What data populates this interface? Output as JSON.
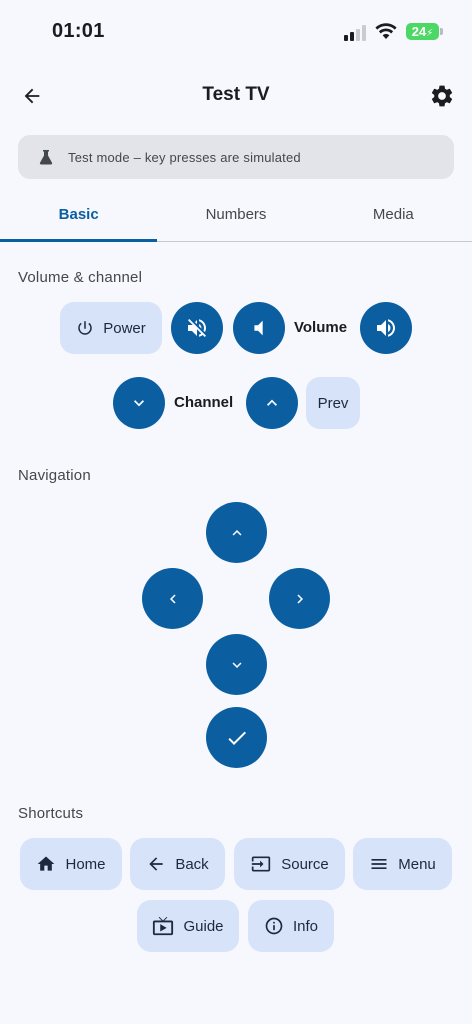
{
  "status_bar": {
    "time": "01:01",
    "battery": "24"
  },
  "header": {
    "title": "Test TV"
  },
  "banner": {
    "text": "Test mode – key presses are simulated"
  },
  "tabs": [
    {
      "label": "Basic",
      "active": true
    },
    {
      "label": "Numbers",
      "active": false
    },
    {
      "label": "Media",
      "active": false
    }
  ],
  "volume_channel": {
    "title": "Volume & channel",
    "power_label": "Power",
    "volume_label": "Volume",
    "channel_label": "Channel",
    "prev_label": "Prev"
  },
  "navigation": {
    "title": "Navigation"
  },
  "shortcuts": {
    "title": "Shortcuts",
    "items": [
      {
        "label": "Home",
        "icon": "home-icon"
      },
      {
        "label": "Back",
        "icon": "arrow-left-icon"
      },
      {
        "label": "Source",
        "icon": "input-source-icon"
      },
      {
        "label": "Menu",
        "icon": "menu-icon"
      },
      {
        "label": "Guide",
        "icon": "tv-guide-icon"
      },
      {
        "label": "Info",
        "icon": "info-icon"
      }
    ]
  },
  "colors": {
    "primary": "#0b5fa1",
    "tonal": "#d7e3f8",
    "background": "#f6f8fd",
    "banner": "#e2e4e9"
  }
}
